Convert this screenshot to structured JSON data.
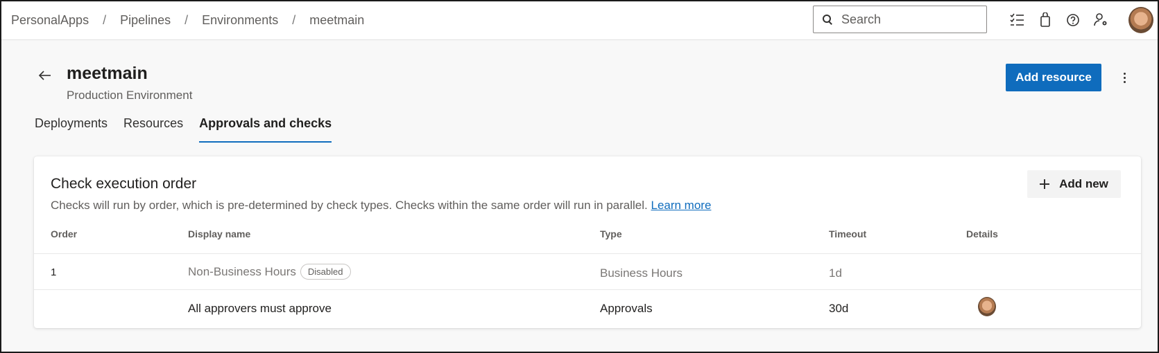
{
  "breadcrumb": {
    "items": [
      "PersonalApps",
      "Pipelines",
      "Environments",
      "meetmain"
    ],
    "separator": "/"
  },
  "search": {
    "placeholder": "Search"
  },
  "toolbar_icons": [
    "task-list-icon",
    "shopping-bag-icon",
    "help-icon",
    "user-settings-icon"
  ],
  "header": {
    "title": "meetmain",
    "subtitle": "Production Environment",
    "primary_action": "Add resource"
  },
  "tabs": [
    {
      "label": "Deployments",
      "active": false
    },
    {
      "label": "Resources",
      "active": false
    },
    {
      "label": "Approvals and checks",
      "active": true
    }
  ],
  "card": {
    "title": "Check execution order",
    "description": "Checks will run by order, which is pre-determined by check types. Checks within the same order will run in parallel.",
    "learn_more": "Learn more",
    "add_new": "Add new",
    "columns": [
      "Order",
      "Display name",
      "Type",
      "Timeout",
      "Details"
    ],
    "rows": [
      {
        "order": "1",
        "name": "Non-Business Hours",
        "badge": "Disabled",
        "type": "Business Hours",
        "timeout": "1d",
        "details": "",
        "disabled": true
      },
      {
        "order": "",
        "name": "All approvers must approve",
        "badge": "",
        "type": "Approvals",
        "timeout": "30d",
        "details": "approver-avatar",
        "disabled": false
      }
    ]
  },
  "colors": {
    "accent": "#0f6cbd",
    "background": "#f8f8f8",
    "card": "#ffffff",
    "muted_text": "#605e5c"
  }
}
